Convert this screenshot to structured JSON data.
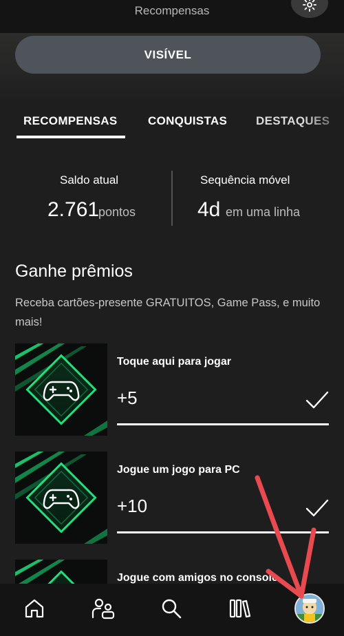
{
  "header": {
    "title": "Recompensas",
    "settings_icon": "gear-icon"
  },
  "visibility_button": {
    "label": "VISÍVEL"
  },
  "tabs": [
    {
      "label": "RECOMPENSAS",
      "active": true
    },
    {
      "label": "CONQUISTAS",
      "active": false
    },
    {
      "label": "DESTAQUES",
      "active": false
    }
  ],
  "stats": {
    "balance": {
      "label": "Saldo atual",
      "value": "2.761",
      "unit": "pontos"
    },
    "streak": {
      "label": "Sequência móvel",
      "value": "4d",
      "unit": "em uma linha"
    }
  },
  "earn_section": {
    "title": "Ganhe prêmios",
    "description": "Receba cartões-presente GRATUITOS, Game Pass, e muito mais!"
  },
  "rewards": [
    {
      "title": "Toque aqui para jogar",
      "points": "+5",
      "completed": true,
      "icon": "controller-icon"
    },
    {
      "title": "Jogue um jogo para PC",
      "points": "+10",
      "completed": true,
      "icon": "controller-icon"
    },
    {
      "title": "Jogue com amigos no console",
      "points": "",
      "completed": false,
      "icon": "controller-icon"
    }
  ],
  "bottom_nav": [
    {
      "name": "home",
      "icon": "home-icon"
    },
    {
      "name": "social",
      "icon": "people-icon"
    },
    {
      "name": "search",
      "icon": "search-icon"
    },
    {
      "name": "library",
      "icon": "library-icon"
    },
    {
      "name": "profile",
      "icon": "avatar"
    }
  ],
  "colors": {
    "background": "#1e1e1e",
    "bar": "#141414",
    "accent_green": "#19e07a",
    "annotation_red": "#e84a4f"
  }
}
